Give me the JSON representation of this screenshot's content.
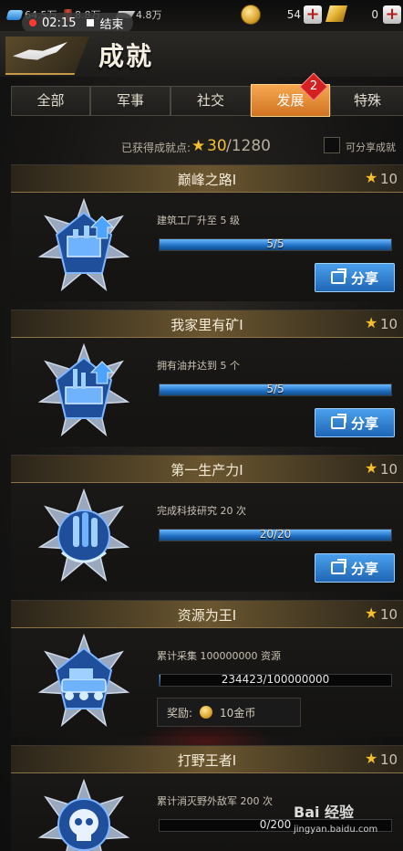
{
  "status_bar": {
    "gem_amount": "64.5万",
    "oil_amount": "8.8万",
    "steel_amount": "4.8万",
    "rec_time": "02:15",
    "rec_stop_label": "结束",
    "coin_amount": "54",
    "gold_amount": "0"
  },
  "header": {
    "title": "成就"
  },
  "tabs": [
    {
      "label": "全部"
    },
    {
      "label": "军事"
    },
    {
      "label": "社交"
    },
    {
      "label": "发展",
      "badge": "2",
      "active": true
    },
    {
      "label": "特殊"
    }
  ],
  "points": {
    "label": "已获得成就点:",
    "value": "30",
    "total": "/1280",
    "shareable_label": "可分享成就"
  },
  "achievements": [
    {
      "title": "巅峰之路Ⅰ",
      "points": "10",
      "desc": "建筑工厂升至 5 级",
      "progress_text": "5/5",
      "progress": 1.0,
      "action": "分享",
      "badge_icon": "factory-badge-icon"
    },
    {
      "title": "我家里有矿Ⅰ",
      "points": "10",
      "desc": "拥有油井达到 5 个",
      "progress_text": "5/5",
      "progress": 1.0,
      "action": "分享",
      "badge_icon": "oil-well-badge-icon"
    },
    {
      "title": "第一生产力Ⅰ",
      "points": "10",
      "desc": "完成科技研究 20 次",
      "progress_text": "20/20",
      "progress": 1.0,
      "action": "分享",
      "badge_icon": "research-badge-icon"
    },
    {
      "title": "资源为王Ⅰ",
      "points": "10",
      "desc": "累计采集 100000000 资源",
      "progress_text": "234423/100000000",
      "progress": 0.002,
      "reward_label": "奖励:",
      "reward_value": "10金币",
      "badge_icon": "resource-badge-icon"
    },
    {
      "title": "打野王者Ⅰ",
      "points": "10",
      "desc": "累计消灭野外敌军 200 次",
      "progress_text": "0/200",
      "progress": 0.0,
      "badge_icon": "skull-badge-icon"
    }
  ],
  "watermark": {
    "logo_text": "Bai 经验",
    "url": "jingyan.baidu.com"
  },
  "colors": {
    "accent_orange": "#e08a32",
    "star_gold": "#f3bf2e",
    "share_blue": "#2f80d0",
    "progress_blue": "#1f6ec2"
  }
}
